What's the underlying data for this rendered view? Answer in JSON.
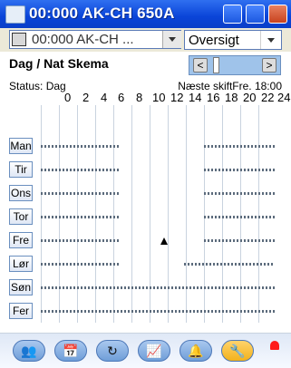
{
  "window": {
    "title": "00:000 AK-CH 650A"
  },
  "toolbar": {
    "device_value": "00:000 AK-CH ...",
    "view_value": "Oversigt"
  },
  "schedule": {
    "title": "Dag / Nat Skema",
    "status": "Status: Dag",
    "next_shift": "Næste skiftFre. 18:00",
    "hour_labels": [
      "0",
      "2",
      "4",
      "6",
      "8",
      "10",
      "12",
      "14",
      "16",
      "18",
      "20",
      "22",
      "24"
    ],
    "days": [
      "Man",
      "Tir",
      "Ons",
      "Tor",
      "Fre",
      "Lør",
      "Søn",
      "Fer"
    ]
  },
  "bottom_nav": {
    "icons": [
      "people-icon",
      "calendar-icon",
      "refresh-icon",
      "graph-icon",
      "bell-icon",
      "wrench-icon"
    ]
  },
  "colors": {
    "titlebar": "#0a44d8",
    "accent": "#6f9ed8",
    "alarm": "#ff1a1a"
  }
}
